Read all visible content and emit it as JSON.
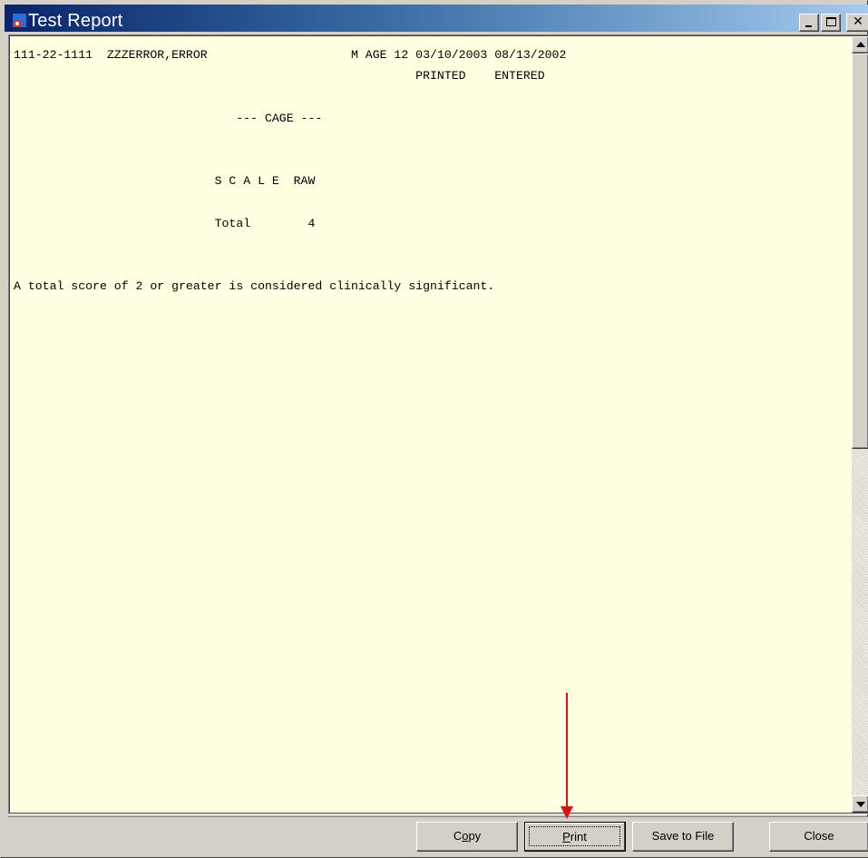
{
  "window": {
    "title": "Test Report",
    "app_icon": "test-report-app-icon",
    "caption_buttons": {
      "minimize": "minimize-icon",
      "maximize": "maximize-icon",
      "close_glyph": "✕"
    }
  },
  "report": {
    "lines": [
      "111-22-1111  ZZZERROR,ERROR                    M AGE 12 03/10/2003 08/13/2002",
      "                                                        PRINTED    ENTERED",
      "",
      "                               --- CAGE ---",
      "",
      "",
      "                            S C A L E  RAW",
      "",
      "                            Total        4",
      "",
      "",
      "A total score of 2 or greater is considered clinically significant."
    ],
    "background_color": "#ffffe1"
  },
  "scrollbar": {
    "up_icon": "scroll-up-arrow-icon",
    "down_icon": "scroll-down-arrow-icon"
  },
  "buttons": {
    "copy": {
      "prefix": "C",
      "underlined": "o",
      "suffix": "py"
    },
    "print": "Print",
    "save": "Save to File",
    "close": "Close"
  },
  "annotation": {
    "arrow_color": "#dd1111",
    "target": "print-button"
  }
}
